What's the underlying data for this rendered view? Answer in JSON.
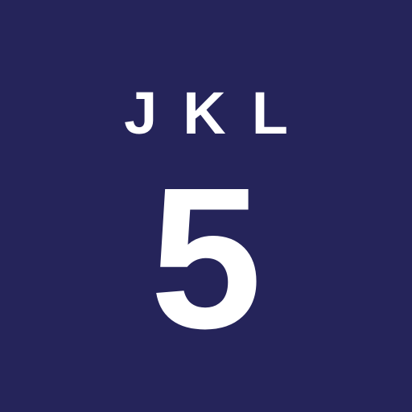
{
  "key": {
    "letters": "JKL",
    "digit": "5",
    "background_color": "#25245a",
    "text_color": "#ffffff"
  }
}
